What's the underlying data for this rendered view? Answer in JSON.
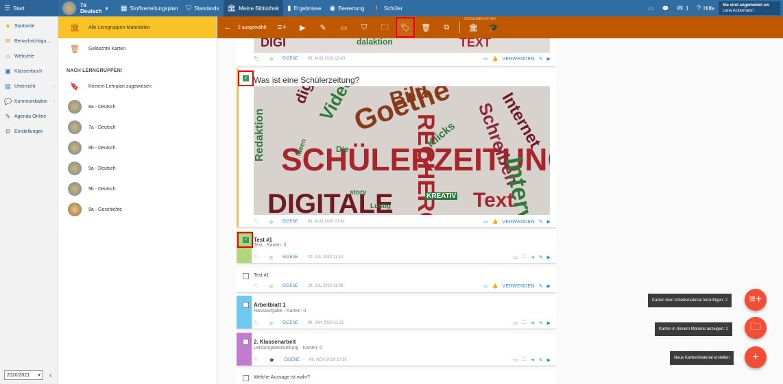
{
  "topbar": {
    "start": "Start",
    "class_num": "7a",
    "class_subject": "Deutsch",
    "nav": [
      "Stoffverteilungsplan",
      "Standards",
      "Meine Bibliothek",
      "Ergebnisse",
      "Bewertung",
      "Schüler"
    ],
    "mail_count": "1",
    "help": "Hilfe",
    "user_label": "Sie sind angemeldet als",
    "user_name": "Lena Ackermann"
  },
  "sidebar": {
    "items": [
      "Startseite",
      "Benachrichtigu...",
      "Webseite",
      "Klassenbuch",
      "Unterricht",
      "Kommunikation",
      "Agenda Online",
      "Einstellungen"
    ],
    "year": "2020/2021"
  },
  "groups": {
    "top": [
      "Alle Lerngruppen-Materialien",
      "Gelöschte Karten"
    ],
    "heading": "NACH LERNGRUPPEN:",
    "items": [
      "Keinem Lehrplan zugewiesen",
      "8a - Deutsch",
      "7a - Deutsch",
      "8b - Deutsch",
      "9a - Deutsch",
      "9b - Deutsch",
      "9a - Geschichte"
    ]
  },
  "actionbar": {
    "selected": "2 ausgewählt:",
    "section_label": "SCHULBIBLIOTHEK"
  },
  "cards": {
    "c0": {
      "own": "EIGENE",
      "date": "03. AUG 2020 12:43",
      "use": "VERWENDEN"
    },
    "c1": {
      "title": "Was ist eine Schülerzeitung?",
      "own": "EIGENE",
      "date": "03. AUG 2020 13:41",
      "use": "VERWENDEN"
    },
    "c2": {
      "title": "Test #1",
      "sub": "Test · Karten: 3",
      "own": "EIGENE",
      "date": "20. JUL 2020 11:10"
    },
    "c3": {
      "title": "Test #1",
      "own": "EIGENE",
      "date": "20. JUL 2020 11:09",
      "use": "VERWENDEN"
    },
    "c4": {
      "title": "Arbeitblatt 1",
      "sub": "Hausaufgabe · Karten: 0",
      "own": "EIGENE",
      "date": "08. JAN 2020 11:31"
    },
    "c5": {
      "title": "2. Klassenarbeit",
      "sub": "Leistungsteststellung · Karten: 0",
      "own": "EIGENE",
      "date": "08. NOV 2019 10:36"
    },
    "c6": {
      "title": "Welche Aussage ist wahr?"
    }
  },
  "wordcloud": {
    "words": [
      "SCHÜLERZEITUNG",
      "DIGITALE",
      "Goethe",
      "RECHERCHE",
      "Schreiben",
      "Interview",
      "Bild",
      "Video",
      "digitale",
      "Klicks",
      "Redaktion",
      "story",
      "Lustig",
      "KREATIV",
      "Ideen",
      "Die",
      "Internet",
      "Text"
    ]
  },
  "fabs": {
    "add_label": "Karten dem Arbeitsmaterial hinzufügen: 2",
    "show_label": "Karten in diesem Material anzeigen: 1",
    "new_label": "Neue Karten/Material erstellen"
  },
  "colors": {
    "topbar": "#2f6da3",
    "actionbar": "#c05800",
    "selected_group": "#f8c325",
    "fab": "#f24d35",
    "check": "#3c9a5f"
  }
}
